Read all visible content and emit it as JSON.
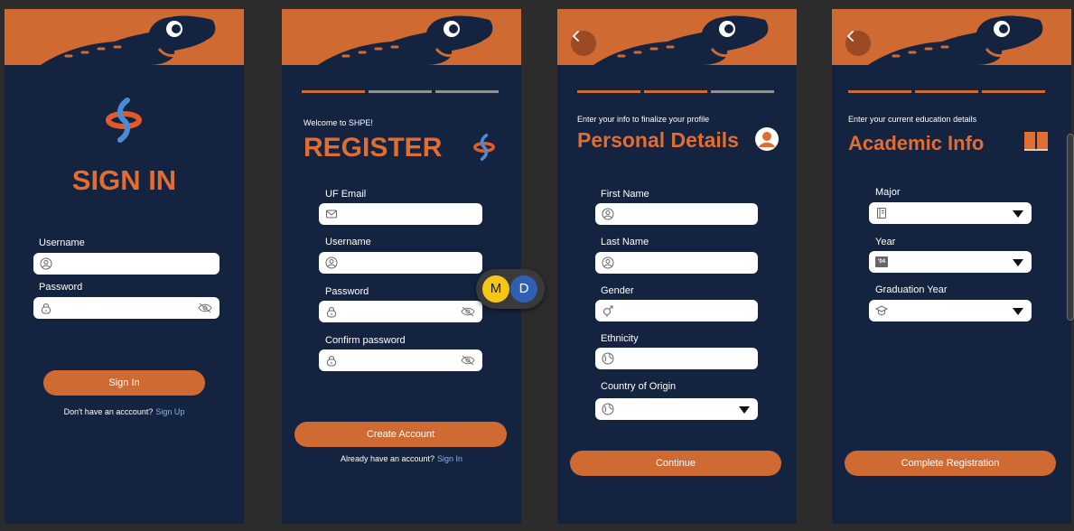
{
  "colors": {
    "banner": "#cf6a33",
    "screen_bg": "#14233f",
    "accent": "#e06e33",
    "link": "#8ab4e6"
  },
  "signin": {
    "title": "SIGN IN",
    "username_label": "Username",
    "password_label": "Password",
    "button": "Sign In",
    "footer_text": "Don't have an acccount?",
    "footer_link": "Sign Up"
  },
  "register": {
    "welcome": "Welcome to SHPE!",
    "title": "REGISTER",
    "progress_step": 1,
    "email_label": "UF Email",
    "username_label": "Username",
    "password_label": "Password",
    "confirm_label": "Confirm password",
    "button": "Create Account",
    "footer_text": "Already have an account?",
    "footer_link": "Sign In"
  },
  "personal": {
    "subtitle": "Enter your info to finalize your profile",
    "title": "Personal Details",
    "progress_step": 2,
    "first_name_label": "First Name",
    "last_name_label": "Last Name",
    "gender_label": "Gender",
    "ethnicity_label": "Ethnicity",
    "country_label": "Country of Origin",
    "button": "Continue"
  },
  "academic": {
    "subtitle": "Enter your current education details",
    "title": "Academic Info",
    "progress_step": 3,
    "major_label": "Major",
    "year_label": "Year",
    "grad_year_label": "Graduation Year",
    "year_icon_text": "'04",
    "button": "Complete Registration"
  },
  "collaborators": [
    {
      "initial": "M",
      "color": "#f5c518"
    },
    {
      "initial": "D",
      "color": "#2f5fb3"
    }
  ],
  "icons": [
    "gator-logo",
    "shpe-logo",
    "back-arrow-icon",
    "user-icon",
    "lock-icon",
    "eye-off-icon",
    "mail-icon",
    "gender-icon",
    "globe-icon",
    "notebook-icon",
    "calendar-icon",
    "graduation-cap-icon",
    "book-icon",
    "profile-avatar-icon"
  ]
}
